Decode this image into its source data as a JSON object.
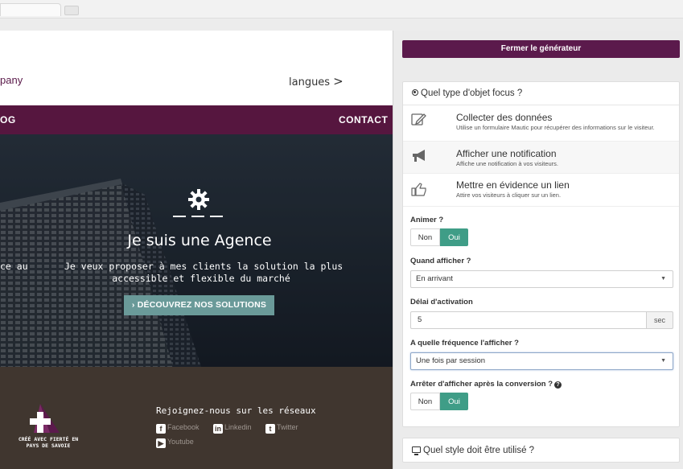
{
  "site": {
    "company": "pany",
    "langues": "langues",
    "langues_arrow": ">",
    "nav_left": "OG",
    "nav_contact": "CONTACT",
    "hero_title": "Je suis une Agence",
    "hero_sub_left": "ce au",
    "hero_sub1": "Je veux proposer à mes clients la solution la plus",
    "hero_sub2": "accessible et flexible du marché",
    "hero_cta": "› DÉCOUVREZ NOS SOLUTIONS",
    "footer_logo_text": "CRÉÉ AVEC FIERTÉ EN PAYS DE SAVOIE",
    "footer_join": "Rejoignez-nous sur les réseaux",
    "social": [
      {
        "icon": "facebook-icon",
        "glyph": "f",
        "label": "Facebook"
      },
      {
        "icon": "linkedin-icon",
        "glyph": "in",
        "label": "Linkedin"
      },
      {
        "icon": "twitter-icon",
        "glyph": "t",
        "label": "Twitter"
      },
      {
        "icon": "youtube-icon",
        "glyph": "▶",
        "label": "Youtube"
      }
    ]
  },
  "panel": {
    "close_label": "Fermer le générateur",
    "type_header": "Quel type d'objet focus ?",
    "options": [
      {
        "icon": "pencil-edit-icon",
        "title": "Collecter des données",
        "desc": "Utilise un formulaire Mautic pour récupérer des informations sur le visiteur."
      },
      {
        "icon": "megaphone-icon",
        "title": "Afficher une notification",
        "desc": "Affiche une notification à vos visiteurs."
      },
      {
        "icon": "hand-pointer-icon",
        "title": "Mettre en évidence un lien",
        "desc": "Attire vos visiteurs à cliquer sur un lien."
      }
    ],
    "animate_label": "Animer ?",
    "animate_off": "Non",
    "animate_on": "Oui",
    "when_label": "Quand afficher ?",
    "when_value": "En arrivant",
    "delay_label": "Délai d'activation",
    "delay_value": "5",
    "delay_unit": "sec",
    "freq_label": "A quelle fréquence l'afficher ?",
    "freq_value": "Une fois par session",
    "stop_label": "Arrêter d'afficher après la conversion ?",
    "stop_off": "Non",
    "stop_on": "Oui",
    "style_header": "Quel style doit être utilisé ?"
  },
  "colors": {
    "brand_purple": "#56163f",
    "button_purple": "#5b1a4c",
    "toggle_green": "#3f9d87",
    "cta_teal": "#6a9a99",
    "footer_brown": "#40362f"
  }
}
